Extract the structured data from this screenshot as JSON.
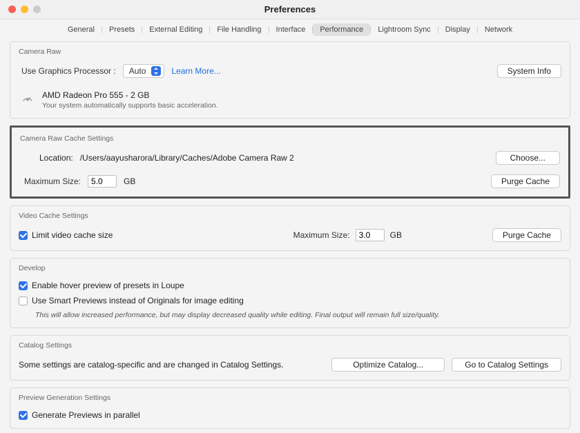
{
  "window": {
    "title": "Preferences"
  },
  "tabs": [
    "General",
    "Presets",
    "External Editing",
    "File Handling",
    "Interface",
    "Performance",
    "Lightroom Sync",
    "Display",
    "Network"
  ],
  "active_tab": "Performance",
  "camera_raw": {
    "title": "Camera Raw",
    "gpu_label": "Use Graphics Processor :",
    "gpu_value": "Auto",
    "learn_more": "Learn More...",
    "system_info": "System Info",
    "gpu_name": "AMD Radeon Pro 555 - 2 GB",
    "gpu_sub": "Your system automatically supports basic acceleration."
  },
  "cache": {
    "title": "Camera Raw Cache Settings",
    "location_label": "Location:",
    "location_path": "/Users/aayusharora/Library/Caches/Adobe Camera Raw 2",
    "choose": "Choose...",
    "max_label": "Maximum Size:",
    "max_value": "5.0",
    "unit": "GB",
    "purge": "Purge Cache"
  },
  "video_cache": {
    "title": "Video Cache Settings",
    "limit_label": "Limit video cache size",
    "max_label": "Maximum Size:",
    "max_value": "3.0",
    "unit": "GB",
    "purge": "Purge Cache"
  },
  "develop": {
    "title": "Develop",
    "hover_label": "Enable hover preview of presets in Loupe",
    "smart_label": "Use Smart Previews instead of Originals for image editing",
    "hint": "This will allow increased performance, but may display decreased quality while editing. Final output will remain full size/quality."
  },
  "catalog": {
    "title": "Catalog Settings",
    "text": "Some settings are catalog-specific and are changed in Catalog Settings.",
    "optimize": "Optimize Catalog...",
    "goto": "Go to Catalog Settings"
  },
  "preview": {
    "title": "Preview Generation Settings",
    "parallel_label": "Generate Previews in parallel"
  }
}
